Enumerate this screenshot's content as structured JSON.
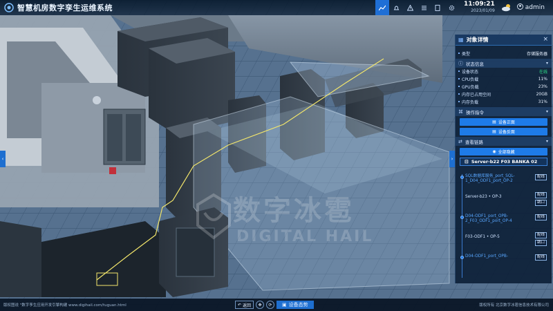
{
  "header": {
    "title": "智慧机房数字孪生运维系统",
    "time": "11:09:21",
    "date": "2023/01/09",
    "user": "admin",
    "toolbar_icons": [
      "chart-icon",
      "bell-icon",
      "warning-icon",
      "list-icon",
      "document-icon",
      "gear-icon"
    ]
  },
  "panel": {
    "title": "对象详情",
    "basic": [
      {
        "key": "类型",
        "value": "存储服务器"
      }
    ],
    "status_section": "状态信息",
    "status": [
      {
        "key": "设备状态",
        "value": "在线"
      },
      {
        "key": "CPU负载",
        "value": "11%"
      },
      {
        "key": "GPU负载",
        "value": "23%"
      },
      {
        "key": "内存已占用空间",
        "value": "20GB"
      },
      {
        "key": "内存负载",
        "value": "31%"
      }
    ],
    "ops_section": "操作指令",
    "ops_buttons": [
      "设备正面",
      "设备反面"
    ],
    "links_section": "查看链路",
    "show_all": "全部隐藏",
    "server_name": "Server-b22 F03 BANKA 02",
    "links": [
      {
        "name": "SQL数据库服务_port_SQL-1_D04_ODF1_port_OP-2",
        "action": "配线",
        "blue": true
      },
      {
        "name": "Server-b23 • OP-3",
        "action": "跳口",
        "blue": false,
        "extra": "配线"
      },
      {
        "name": "D04-ODF1_port_OPB-2_F03_ODF1_port_OP-4",
        "action": "配线",
        "blue": true
      },
      {
        "name": "F03-ODF1 • OP-5",
        "action": "跳口",
        "blue": false,
        "extra": "配线"
      },
      {
        "name": "D04-ODF1_port_OPB-",
        "action": "配线",
        "blue": true
      }
    ]
  },
  "watermark": {
    "cn": "数字冰雹",
    "en": "DIGITAL HAIL"
  },
  "footer": {
    "left": "版权图说 \"数字孪生应用开发引擎构建 www.digihail.com/tuguan.html",
    "right": "版权所有 北京数字冰雹信息技术有限公司",
    "back": "返回",
    "primary": "设备态势"
  },
  "colors": {
    "accent": "#1e7be8",
    "online": "#2fe38a"
  }
}
